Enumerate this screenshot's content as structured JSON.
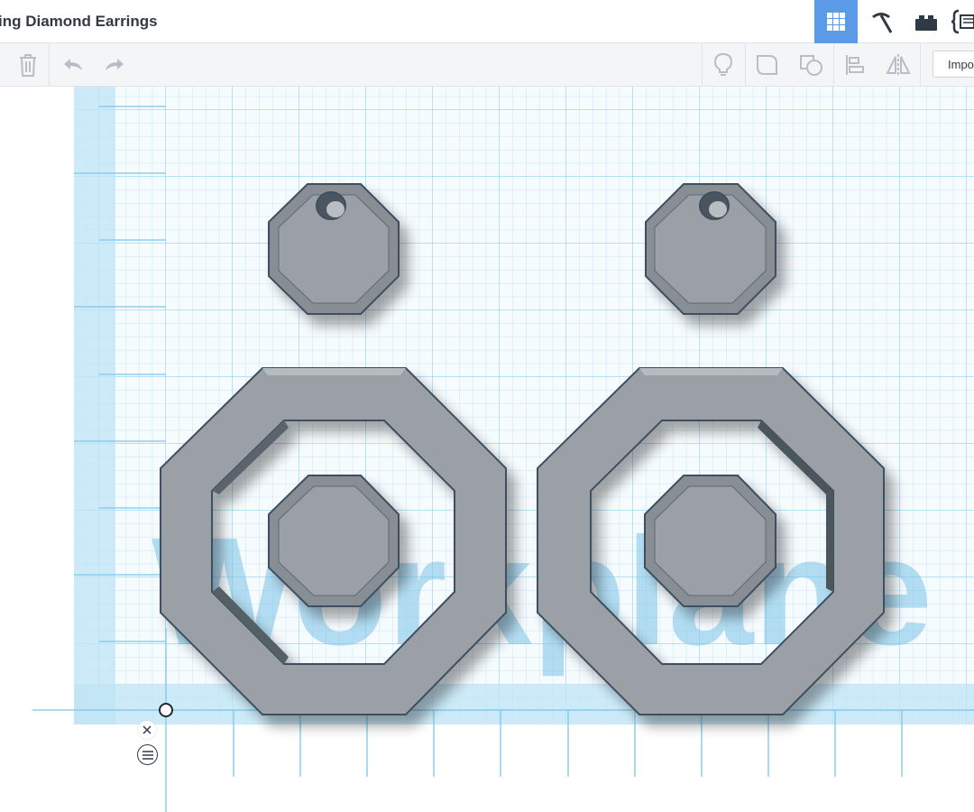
{
  "header": {
    "title": "ing Diamond Earrings",
    "modes": [
      {
        "icon": "grid-icon",
        "active": true
      },
      {
        "icon": "pickaxe-icon",
        "active": false
      },
      {
        "icon": "brick-icon",
        "active": false
      },
      {
        "icon": "code-blocks-icon",
        "active": false
      }
    ]
  },
  "toolbar": {
    "import_label": "Import"
  },
  "workplane": {
    "watermark": "Workplane"
  },
  "colors": {
    "accent": "#5a9ae8",
    "grid_line": "#bfe2f3",
    "grid_major": "#8fd0ee",
    "shape_top": "#9aa0a6",
    "shape_edge": "#3e4f60"
  }
}
